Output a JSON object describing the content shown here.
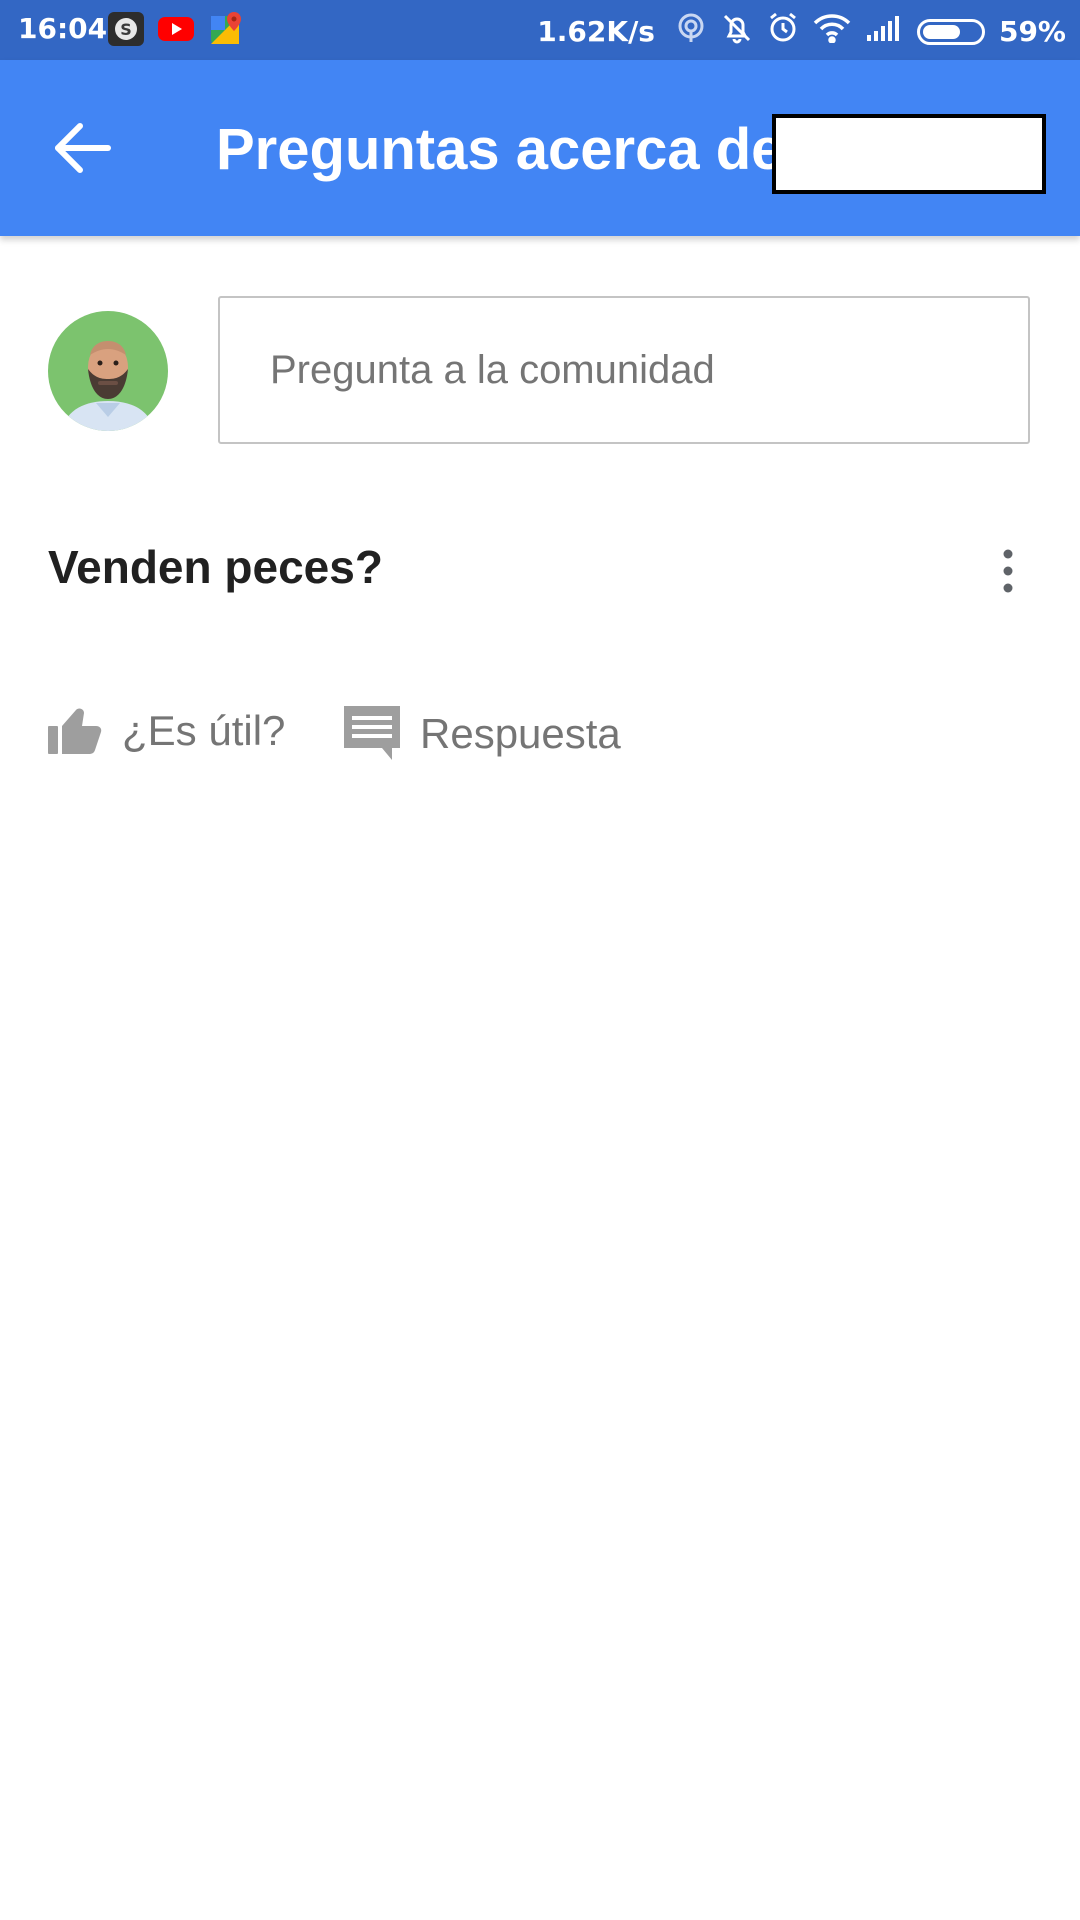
{
  "status_bar": {
    "time": "16:04",
    "network_speed": "1.62K/s",
    "battery_percent": "59%",
    "battery_level": 0.59,
    "app_icons": [
      "slack-icon",
      "youtube-icon",
      "maps-icon"
    ],
    "system_icons": [
      "hotspot-icon",
      "bell-off-icon",
      "alarm-icon",
      "wifi-icon",
      "signal-icon",
      "battery-icon"
    ]
  },
  "app_bar": {
    "title": "Preguntas acerca de",
    "background": "#4285f4"
  },
  "ask": {
    "placeholder": "Pregunta a la comunidad"
  },
  "question": {
    "text": "Venden peces?"
  },
  "actions": {
    "helpful_label": "¿Es útil?",
    "answer_label": "Respuesta"
  },
  "colors": {
    "status_bar": "#3367c4",
    "app_bar": "#4285f4",
    "action_gray": "#757575",
    "text_dark": "#212121"
  }
}
